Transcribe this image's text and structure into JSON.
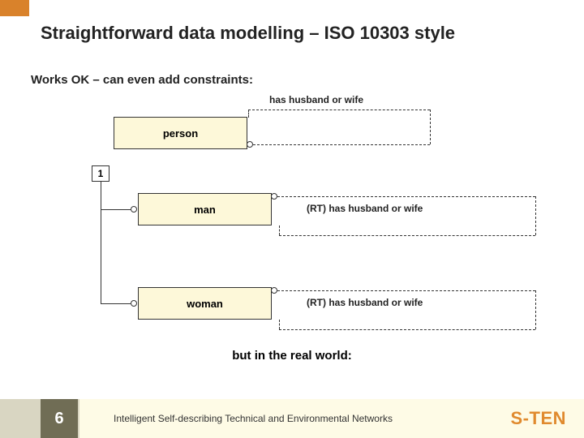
{
  "title": "Straightforward data modelling – ISO 10303 style",
  "subtitle": "Works OK – can even add constraints:",
  "diagram": {
    "rel_label": "has husband or wife",
    "entities": {
      "person": "person",
      "man": "man",
      "woman": "woman"
    },
    "constraint": "1",
    "rt_label_man": "(RT) has husband or wife",
    "rt_label_woman": "(RT) has husband or wife"
  },
  "real_world": "but in the real world:",
  "footer": {
    "page": "6",
    "caption": "Intelligent Self-describing Technical and Environmental Networks",
    "brand": "S-TEN"
  }
}
